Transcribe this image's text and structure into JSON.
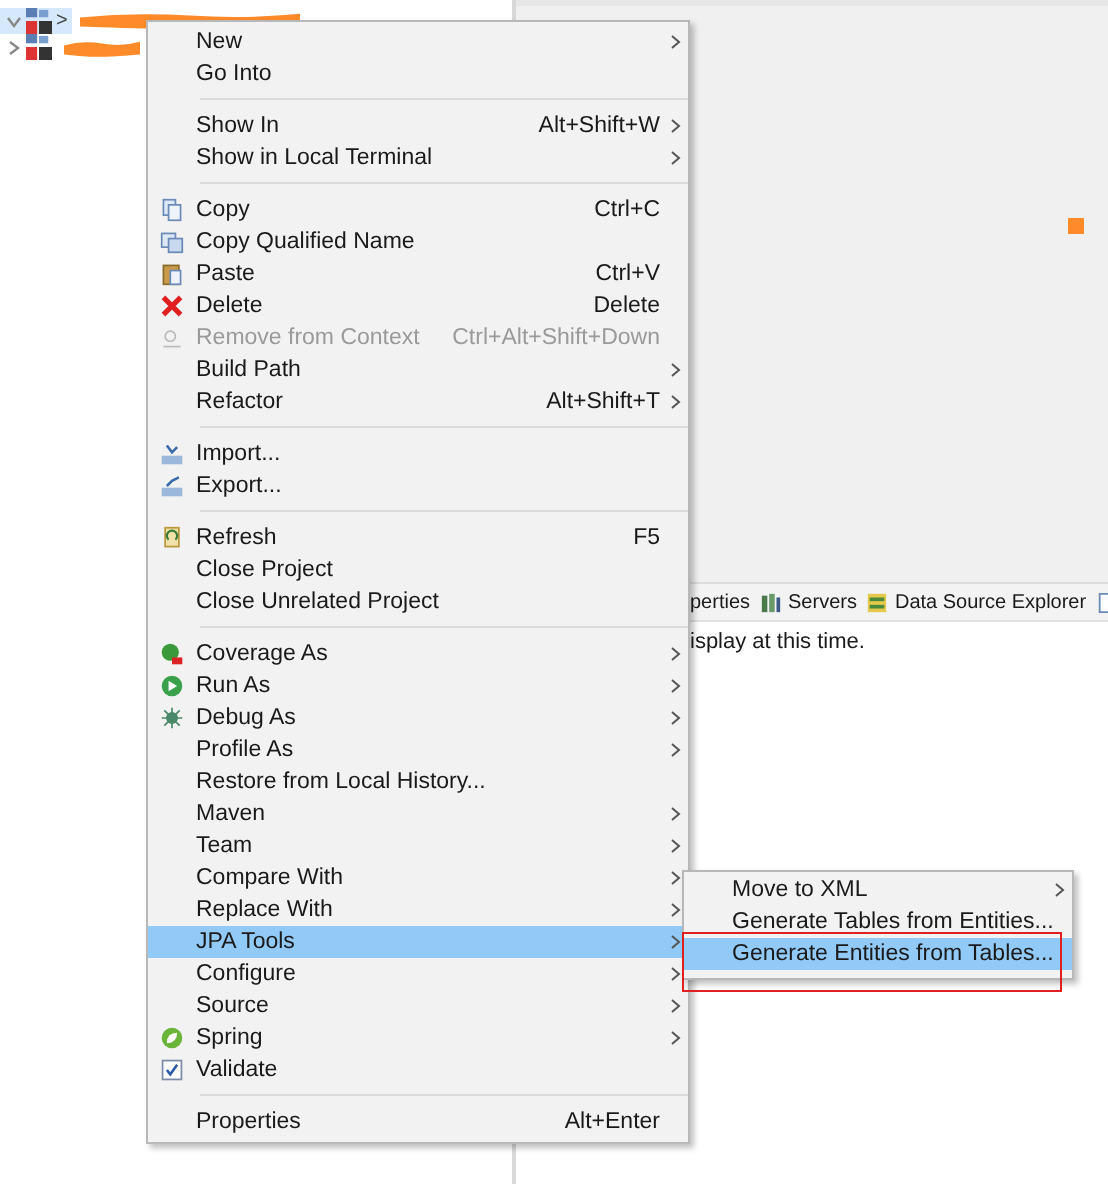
{
  "tree": [
    {
      "expanded": true,
      "selected": true,
      "label": ">"
    },
    {
      "expanded": false,
      "selected": false
    }
  ],
  "panel": {
    "tabs": [
      {
        "label": "perties"
      },
      {
        "label": "Servers"
      },
      {
        "label": "Data Source Explorer"
      }
    ],
    "message": "isplay at this time."
  },
  "context_menu": {
    "items": [
      {
        "kind": "item",
        "label": "New",
        "submenu": true
      },
      {
        "kind": "item",
        "label": "Go Into"
      },
      {
        "kind": "separator"
      },
      {
        "kind": "item",
        "label": "Show In",
        "shortcut": "Alt+Shift+W",
        "submenu": true
      },
      {
        "kind": "item",
        "label": "Show in Local Terminal",
        "submenu": true
      },
      {
        "kind": "separator"
      },
      {
        "kind": "item",
        "label": "Copy",
        "shortcut": "Ctrl+C"
      },
      {
        "kind": "item",
        "label": "Copy Qualified Name"
      },
      {
        "kind": "item",
        "label": "Paste",
        "shortcut": "Ctrl+V"
      },
      {
        "kind": "item",
        "label": "Delete",
        "shortcut": "Delete"
      },
      {
        "kind": "item",
        "label": "Remove from Context",
        "shortcut": "Ctrl+Alt+Shift+Down",
        "disabled": true
      },
      {
        "kind": "item",
        "label": "Build Path",
        "submenu": true
      },
      {
        "kind": "item",
        "label": "Refactor",
        "shortcut": "Alt+Shift+T",
        "submenu": true
      },
      {
        "kind": "separator"
      },
      {
        "kind": "item",
        "label": "Import..."
      },
      {
        "kind": "item",
        "label": "Export..."
      },
      {
        "kind": "separator"
      },
      {
        "kind": "item",
        "label": "Refresh",
        "shortcut": "F5"
      },
      {
        "kind": "item",
        "label": "Close Project"
      },
      {
        "kind": "item",
        "label": "Close Unrelated Project"
      },
      {
        "kind": "separator"
      },
      {
        "kind": "item",
        "label": "Coverage As",
        "submenu": true
      },
      {
        "kind": "item",
        "label": "Run As",
        "submenu": true
      },
      {
        "kind": "item",
        "label": "Debug As",
        "submenu": true
      },
      {
        "kind": "item",
        "label": "Profile As",
        "submenu": true
      },
      {
        "kind": "item",
        "label": "Restore from Local History..."
      },
      {
        "kind": "item",
        "label": "Maven",
        "submenu": true
      },
      {
        "kind": "item",
        "label": "Team",
        "submenu": true
      },
      {
        "kind": "item",
        "label": "Compare With",
        "submenu": true
      },
      {
        "kind": "item",
        "label": "Replace With",
        "submenu": true
      },
      {
        "kind": "item",
        "label": "JPA Tools",
        "submenu": true,
        "selected": true
      },
      {
        "kind": "item",
        "label": "Configure",
        "submenu": true
      },
      {
        "kind": "item",
        "label": "Source",
        "submenu": true
      },
      {
        "kind": "item",
        "label": "Spring",
        "submenu": true
      },
      {
        "kind": "item",
        "label": "Validate"
      },
      {
        "kind": "separator"
      },
      {
        "kind": "item",
        "label": "Properties",
        "shortcut": "Alt+Enter"
      }
    ]
  },
  "submenu": {
    "items": [
      {
        "label": "Move to XML",
        "submenu": true,
        "selected": false
      },
      {
        "label": "Generate Tables from Entities...",
        "submenu": false,
        "selected": false
      },
      {
        "label": "Generate Entities from Tables...",
        "submenu": false,
        "selected": true
      }
    ]
  }
}
